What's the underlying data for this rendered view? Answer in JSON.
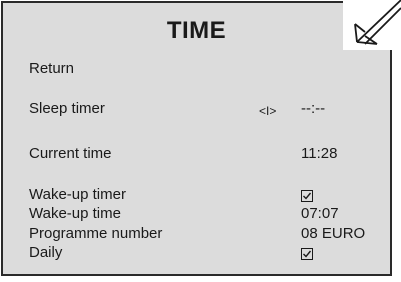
{
  "screen": {
    "title": "TIME",
    "icon": "pointer-arrow-icon",
    "colors": {
      "panel_bg": "#dcdcdc",
      "text": "#1a1a1a",
      "border": "#2a2a2a"
    }
  },
  "menu": {
    "return_label": "Return",
    "sleep_timer": {
      "label": "Sleep timer",
      "nav": "<I>",
      "value": "--:--"
    },
    "current_time": {
      "label": "Current time",
      "value": "11:28"
    },
    "wake_up_timer": {
      "label": "Wake-up timer",
      "checked": true
    },
    "wake_up_time": {
      "label": "Wake-up time",
      "value": "07:07"
    },
    "programme_number": {
      "label": "Programme number",
      "value": "08 EURO"
    },
    "daily": {
      "label": "Daily",
      "checked": true
    }
  }
}
